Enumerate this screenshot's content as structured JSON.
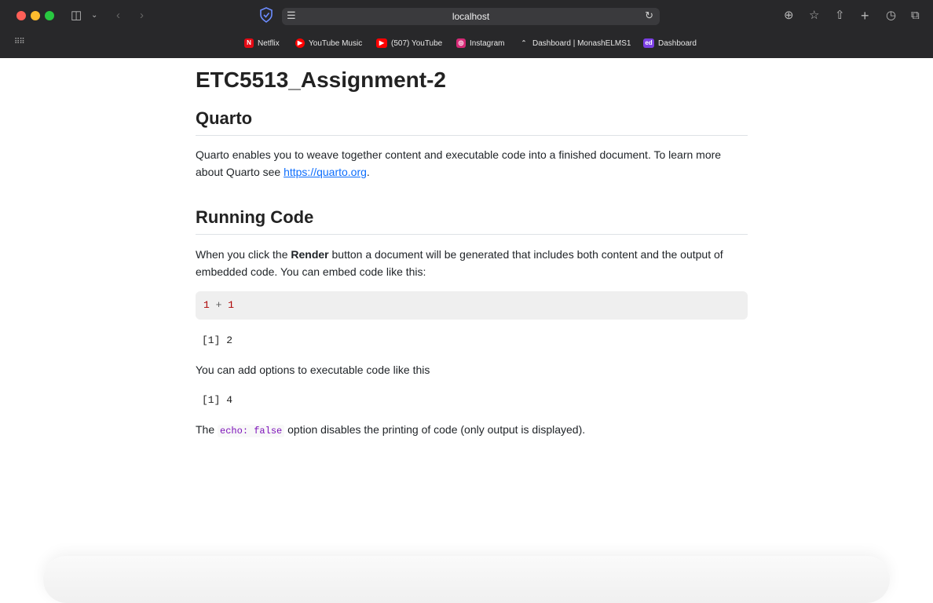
{
  "browser": {
    "address": "localhost",
    "bookmarks": [
      {
        "label": "Netflix",
        "icon": "netflix-icon",
        "color": "#e50914",
        "glyph": "N"
      },
      {
        "label": "YouTube Music",
        "icon": "youtube-music-icon",
        "color": "#ff0000",
        "glyph": "▶"
      },
      {
        "label": "(507) YouTube",
        "icon": "youtube-icon",
        "color": "#ff0000",
        "glyph": "▶"
      },
      {
        "label": "Instagram",
        "icon": "instagram-icon",
        "color": "#d62976",
        "glyph": "◎"
      },
      {
        "label": "Dashboard | MonashELMS1",
        "icon": "moodle-icon",
        "color": "#cfcfcf",
        "glyph": "^"
      },
      {
        "label": "Dashboard",
        "icon": "ed-icon",
        "color": "#7b3fe4",
        "glyph": "ed"
      }
    ]
  },
  "doc": {
    "title": "ETC5513_Assignment-2",
    "quarto_heading": "Quarto",
    "quarto_text_before": "Quarto enables you to weave together content and executable code into a finished document. To learn more about Quarto see ",
    "quarto_link": "https://quarto.org",
    "quarto_text_after": ".",
    "running_heading": "Running Code",
    "running_text_before": "When you click the ",
    "running_bold": "Render",
    "running_text_after": " button a document will be generated that includes both content and the output of embedded code. You can embed code like this:",
    "code_left": "1",
    "code_op": " + ",
    "code_right": "1",
    "output1": "[1] 2",
    "options_text": "You can add options to executable code like this",
    "output2": "[1] 4",
    "echo_before": "The ",
    "echo_code": "echo: false",
    "echo_after": " option disables the printing of code (only output is displayed)."
  }
}
